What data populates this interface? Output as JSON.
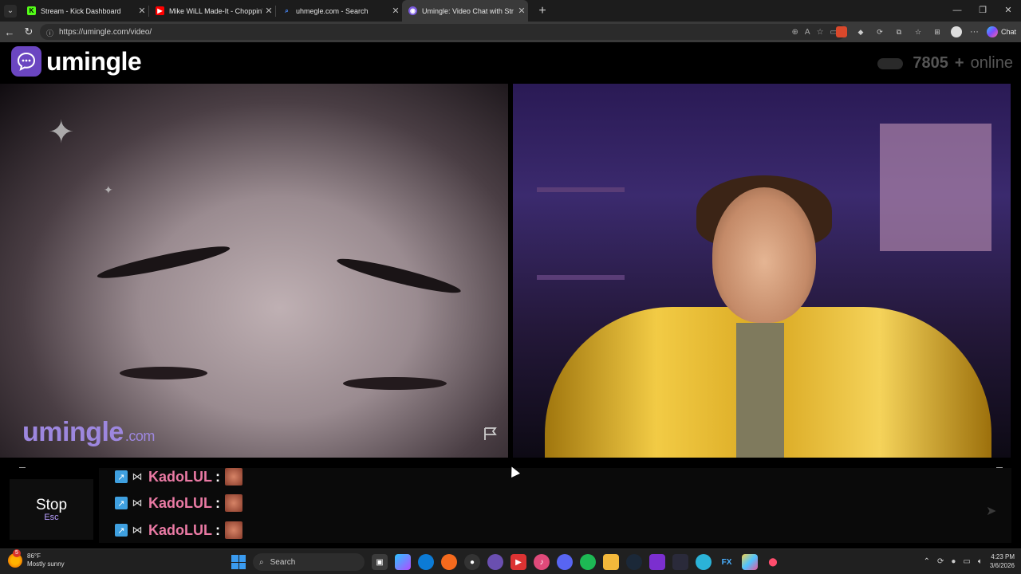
{
  "browser": {
    "tabs": [
      {
        "label": "Stream - Kick Dashboard",
        "icon": "kick-icon",
        "color": "#53fc18",
        "close": "✕"
      },
      {
        "label": "Mike WiLL Made-It - Choppin' Bla",
        "icon": "youtube-icon",
        "color": "#ff0000",
        "close": "✕"
      },
      {
        "label": "uhmegle.com - Search",
        "icon": "search-icon",
        "color": "#4a8cff",
        "close": "✕"
      },
      {
        "label": "Umingle: Video Chat with Str",
        "icon": "umingle-icon",
        "color": "#7c5ce0",
        "close": "✕"
      }
    ],
    "new_tab": "+",
    "url": "https://umingle.com/video/",
    "chat_label": "Chat"
  },
  "site": {
    "logo_text": "umingle",
    "online_count": "7805",
    "online_plus": "+",
    "online_label": "online",
    "watermark_main": "umingle",
    "watermark_domain": ".com",
    "accent": "#6b46c1"
  },
  "controls": {
    "stop_label": "Stop",
    "stop_key": "Esc"
  },
  "chat": {
    "messages": [
      {
        "user": "KadoLUL",
        "sep": ":"
      },
      {
        "user": "KadoLUL",
        "sep": ":"
      },
      {
        "user": "KadoLUL",
        "sep": ":"
      }
    ]
  },
  "taskbar": {
    "temperature": "86°F",
    "weather": "Mostly sunny",
    "notification_count": "5",
    "search_placeholder": "Search",
    "time": "4:23 PM",
    "date": "3/6/2026"
  }
}
